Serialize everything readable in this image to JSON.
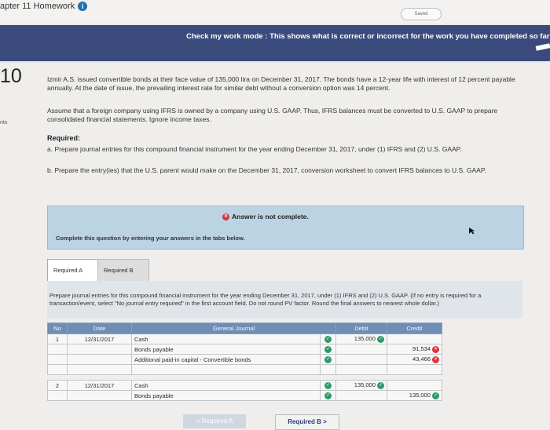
{
  "header": {
    "chapter": "apter 11 Homework",
    "info_icon": "i",
    "saved": "Saved"
  },
  "check_bar": {
    "text": "Check my work mode : This shows what is correct or incorrect for the work you have completed so far"
  },
  "question": {
    "number": "10",
    "points_label": "nts",
    "para1": "Izmir A.S. issued convertible bonds at their face value of 135,000 lira on December 31, 2017. The bonds have a 12-year life with interest of 12 percent payable annually. At the date of issue, the prevailing interest rate for similar debt without a conversion option was 14 percent.",
    "para2": "Assume that a foreign company using IFRS is owned by a company using U.S. GAAP. Thus, IFRS balances must be converted to U.S. GAAP to prepare consolidated financial statements. Ignore income taxes.",
    "required_heading": "Required:",
    "req_a": "a. Prepare journal entries for this compound financial instrument for the year ending December 31, 2017, under (1) IFRS and (2) U.S. GAAP.",
    "req_b": "b. Prepare the entry(ies) that the U.S. parent would make on the December 31, 2017, conversion worksheet to convert IFRS balances to U.S. GAAP."
  },
  "answer": {
    "status": "Answer is not complete.",
    "message": "Complete this question by entering your answers in the tabs below."
  },
  "tabs": [
    {
      "label": "Required A"
    },
    {
      "label": "Required B"
    }
  ],
  "instructions": "Prepare journal entries for this compound financial instrument for the year ending December 31, 2017, under (1) IFRS and (2) U.S. GAAP. (If no entry is required for a transaction/event, select \"No journal entry required\" in the first account field. Do not round PV factor. Round the final answers to nearest whole dollar.)",
  "journal": {
    "headers": {
      "no": "No",
      "date": "Date",
      "account": "General Journal",
      "debit": "Debit",
      "credit": "Credit"
    },
    "rows": [
      {
        "no": "1",
        "date": "12/31/2017",
        "account": "Cash",
        "debit": "135,000",
        "credit": ""
      },
      {
        "no": "",
        "date": "",
        "account": "Bonds payable",
        "debit": "",
        "credit": "91,534"
      },
      {
        "no": "",
        "date": "",
        "account": "Additional paid-in capital - Convertible bonds",
        "debit": "",
        "credit": "43,466"
      },
      {
        "no": "2",
        "date": "12/31/2017",
        "account": "Cash",
        "debit": "135,000",
        "credit": ""
      },
      {
        "no": "",
        "date": "",
        "account": "Bonds payable",
        "debit": "",
        "credit": "135,000"
      }
    ]
  },
  "nav": {
    "prev": "< Required A",
    "next": "Required B >"
  },
  "colors": {
    "check_bar": "#3b4a7c",
    "answer_box": "#bcd3e4",
    "table_header": "#6f8db5",
    "correct": "#2f9a6b",
    "incorrect": "#d9353b"
  }
}
